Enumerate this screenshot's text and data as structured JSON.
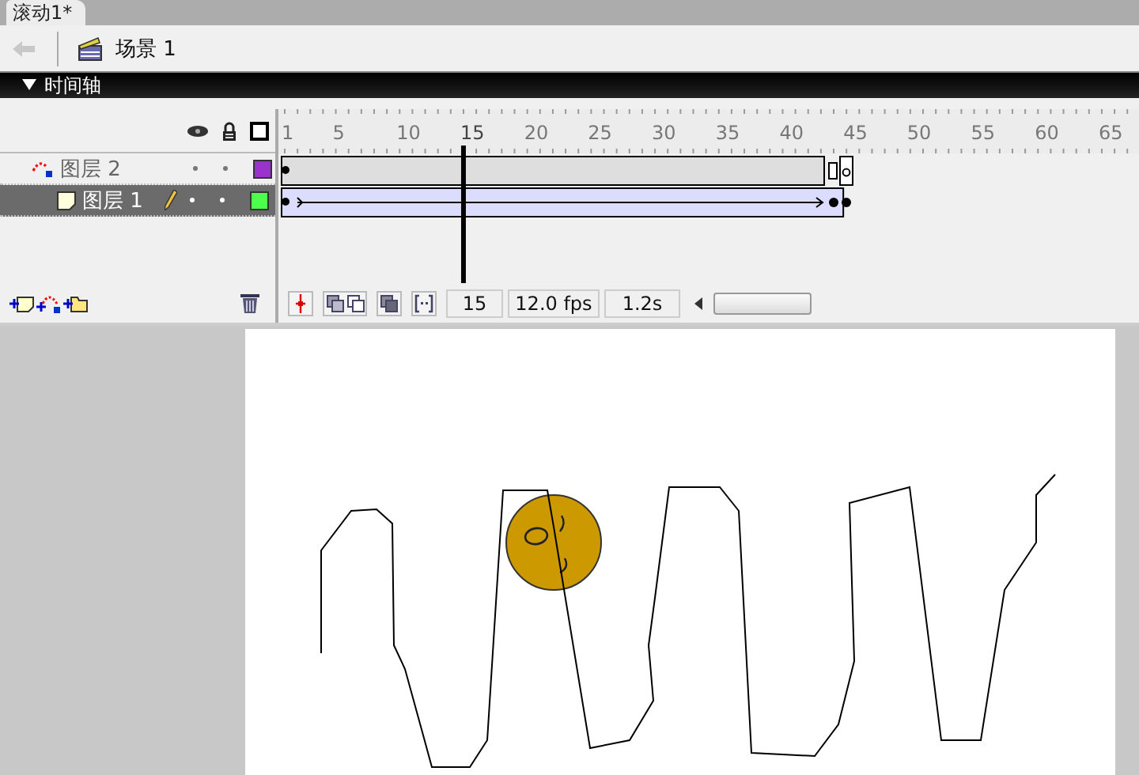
{
  "document_tab": {
    "label": "滚动1*",
    "selected": true
  },
  "scene": {
    "label": "场景 1"
  },
  "timeline": {
    "title": "时间轴",
    "expanded": true
  },
  "ruler": [
    {
      "label": "1",
      "selected": false
    },
    {
      "label": "5",
      "selected": false
    },
    {
      "label": "10",
      "selected": false
    },
    {
      "label": "15",
      "selected": true
    },
    {
      "label": "20",
      "selected": false
    },
    {
      "label": "25",
      "selected": false
    },
    {
      "label": "30",
      "selected": false
    },
    {
      "label": "35",
      "selected": false
    },
    {
      "label": "40",
      "selected": false
    },
    {
      "label": "45",
      "selected": false
    },
    {
      "label": "50",
      "selected": false
    },
    {
      "label": "55",
      "selected": false
    },
    {
      "label": "60",
      "selected": false
    },
    {
      "label": "65",
      "selected": false
    }
  ],
  "layers": [
    {
      "name": "图层 2",
      "kind": "guide",
      "selected": false,
      "editing": false,
      "color": "#9933cc"
    },
    {
      "name": "图层 1",
      "kind": "normal",
      "selected": true,
      "editing": true,
      "color": "#4dff4d"
    }
  ],
  "status": {
    "frame": "15",
    "fps": "12.0 fps",
    "time": "1.2s"
  }
}
